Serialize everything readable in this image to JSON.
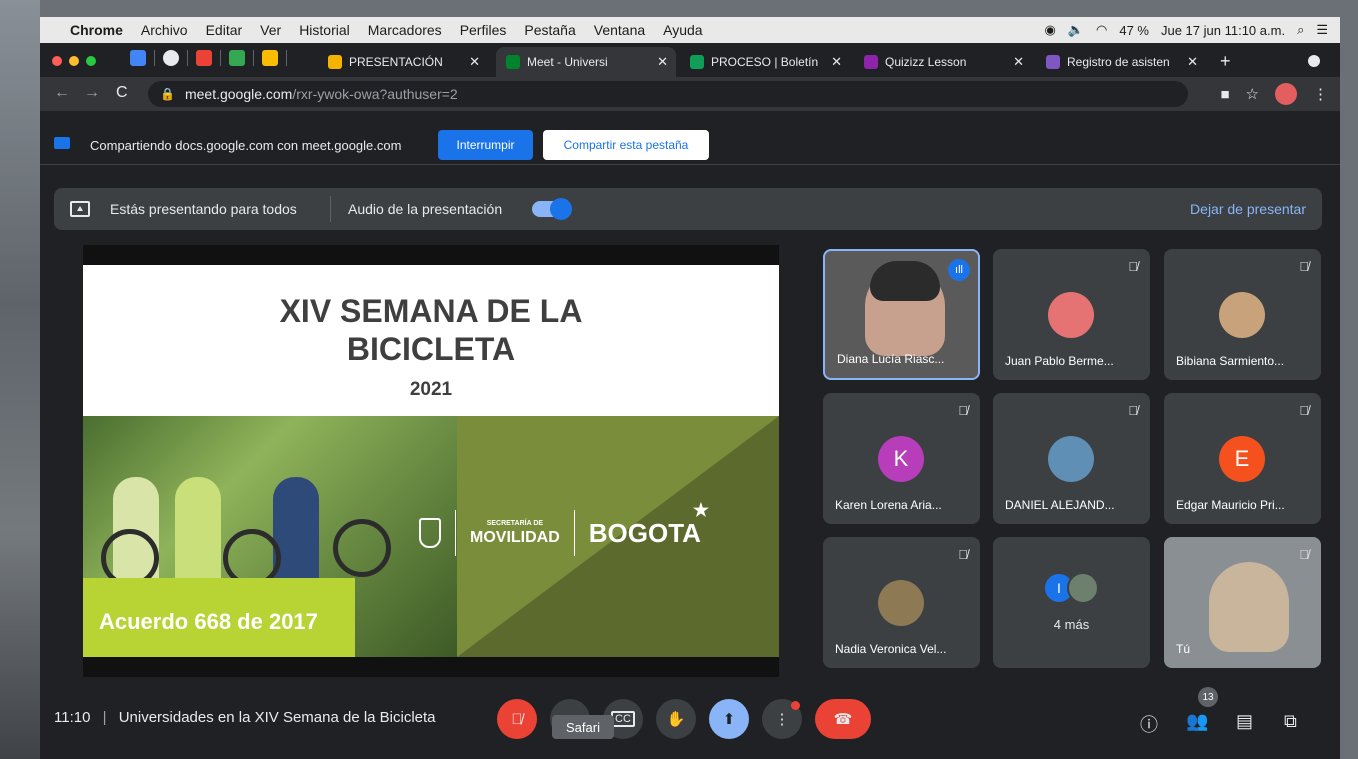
{
  "menubar": {
    "app": "Chrome",
    "items": [
      "Archivo",
      "Editar",
      "Ver",
      "Historial",
      "Marcadores",
      "Perfiles",
      "Pestaña",
      "Ventana",
      "Ayuda"
    ],
    "battery": "47 %",
    "datetime": "Jue 17 jun  11:10 a.m."
  },
  "tabs": [
    {
      "title": "PRESENTACIÓN",
      "color": "#f4b400"
    },
    {
      "title": "Meet - Universi",
      "color": "#00832d",
      "active": true
    },
    {
      "title": "PROCESO | Boletín",
      "color": "#0f9d58"
    },
    {
      "title": "Quizizz Lesson",
      "color": "#8e24aa"
    },
    {
      "title": "Registro de asisten",
      "color": "#7e57c2"
    }
  ],
  "address": {
    "domain": "meet.google.com",
    "path": "/rxr-ywok-owa?authuser=2"
  },
  "sharebar": {
    "text": "Compartiendo docs.google.com con meet.google.com",
    "stop_label": "Interrumpir",
    "share_tab_label": "Compartir esta pestaña"
  },
  "presbar": {
    "presenting": "Estás presentando para todos",
    "audio": "Audio de la presentación",
    "audio_on": true,
    "stop": "Dejar de presentar"
  },
  "slide": {
    "title": "XIV SEMANA DE LA\nBICICLETA",
    "year": "2021",
    "acuerdo": "Acuerdo 668 de 2017",
    "secretaria": "SECRETARÍA DE",
    "movilidad": "MOVILIDAD",
    "bogota": "BOGOTA"
  },
  "participants": [
    {
      "name": "Diana Lucía Riasc...",
      "speaking": true
    },
    {
      "name": "Juan Pablo Berme...",
      "avatar": "photo",
      "color": "#e57373"
    },
    {
      "name": "Bibiana Sarmiento...",
      "avatar": "photo",
      "color": "#c8a27a"
    },
    {
      "name": "Karen Lorena Aria...",
      "avatar": "K",
      "color": "#b83dba"
    },
    {
      "name": "DANIEL ALEJAND...",
      "avatar": "photo",
      "color": "#5f8fb5"
    },
    {
      "name": "Edgar Mauricio Pri...",
      "avatar": "E",
      "color": "#f4511e"
    },
    {
      "name": "Nadia Veronica Vel...",
      "avatar": "photo",
      "color": "#8d7a55"
    },
    {
      "name": "4 más",
      "avatar": "I",
      "color": "#1a73e8"
    },
    {
      "name": "Tú",
      "self": true
    }
  ],
  "bottombar": {
    "time": "11:10",
    "meeting_title": "Universidades en la XIV Semana de la Bicicleta",
    "tooltip": "Safari",
    "participant_count": "13"
  }
}
